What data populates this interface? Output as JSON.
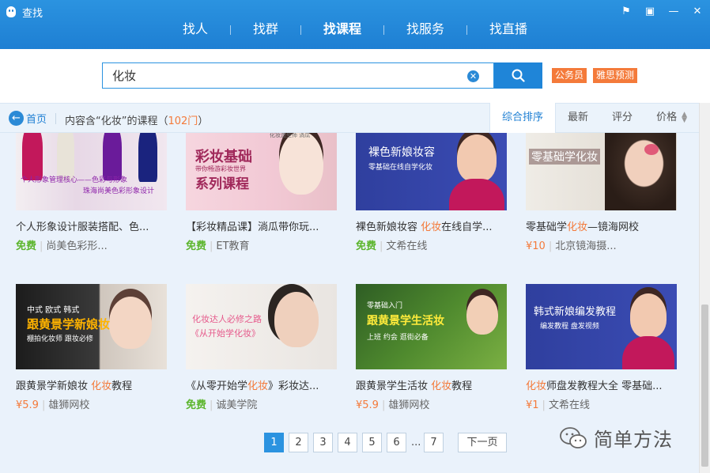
{
  "window": {
    "title": "查找"
  },
  "nav": {
    "tabs": [
      "找人",
      "找群",
      "找课程",
      "找服务",
      "找直播"
    ],
    "active": 2
  },
  "search": {
    "value": "化妆",
    "hot_tags": [
      "公务员",
      "雅思预测"
    ]
  },
  "filter": {
    "home_label": "首页",
    "result_prefix": "内容含“化妆”的课程（",
    "result_count": "102门",
    "result_suffix": "）",
    "sorts": [
      "综合排序",
      "最新",
      "评分",
      "价格"
    ]
  },
  "courses": [
    {
      "title_pre": "个人形象设计服装搭配、色...",
      "title_hl": "",
      "title_post": "",
      "price": "免费",
      "free": true,
      "org": "尚美色彩形...",
      "thumb_text": [
        "个人形象管理核心——色彩与形象",
        "珠海尚美色彩形象设计"
      ]
    },
    {
      "title_pre": "【彩妆精品课】淌瓜带你玩...",
      "title_hl": "",
      "title_post": "",
      "price": "免费",
      "free": true,
      "org": "ET教育",
      "thumb_text": [
        "彩妆基础",
        "带你畅游彩妆世界",
        "系列课程",
        "化妆造型师 淌瓜"
      ]
    },
    {
      "title_pre": "裸色新娘妆容 ",
      "title_hl": "化妆",
      "title_post": "在线自学...",
      "price": "免费",
      "free": true,
      "org": "文希在线",
      "thumb_text": [
        "裸色新娘妆容",
        "零基础在线自学化妆"
      ]
    },
    {
      "title_pre": "零基础学",
      "title_hl": "化妆",
      "title_post": "—镜海网校",
      "price": "¥10",
      "free": false,
      "org": "北京镜海摄...",
      "thumb_text": [
        "零基础学化妆"
      ]
    },
    {
      "title_pre": "跟黄景学新娘妆 ",
      "title_hl": "化妆",
      "title_post": "教程",
      "price": "¥5.9",
      "free": false,
      "org": "雄狮网校",
      "thumb_text": [
        "中式 欧式 韩式",
        "跟黄景学新娘妆",
        "棚拍化妆师 跟妆必修"
      ]
    },
    {
      "title_pre": "《从零开始学",
      "title_hl": "化妆",
      "title_post": "》彩妆达...",
      "price": "免费",
      "free": true,
      "org": "诚美学院",
      "thumb_text": [
        "化妆达人必修之路",
        "《从开始学化妆》"
      ]
    },
    {
      "title_pre": "跟黄景学生活妆 ",
      "title_hl": "化妆",
      "title_post": "教程",
      "price": "¥5.9",
      "free": false,
      "org": "雄狮网校",
      "thumb_text": [
        "零基础入门",
        "跟黄景学生活妆",
        "上班 约会 逛街必备"
      ]
    },
    {
      "title_pre": "",
      "title_hl": "化妆",
      "title_post": "师盘发教程大全 零基础...",
      "price": "¥1",
      "free": false,
      "org": "文希在线",
      "thumb_text": [
        "韩式新娘编发教程",
        "编发教程 盘发视频"
      ]
    }
  ],
  "pagination": {
    "pages": [
      "1",
      "2",
      "3",
      "4",
      "5",
      "6"
    ],
    "dots": "...",
    "last": "7",
    "next": "下一页",
    "current": "1"
  },
  "watermark": "简单方法",
  "colors": {
    "brand_blue": "#1e7fd3",
    "accent_orange": "#f47a3a",
    "free_green": "#5bb52c"
  }
}
